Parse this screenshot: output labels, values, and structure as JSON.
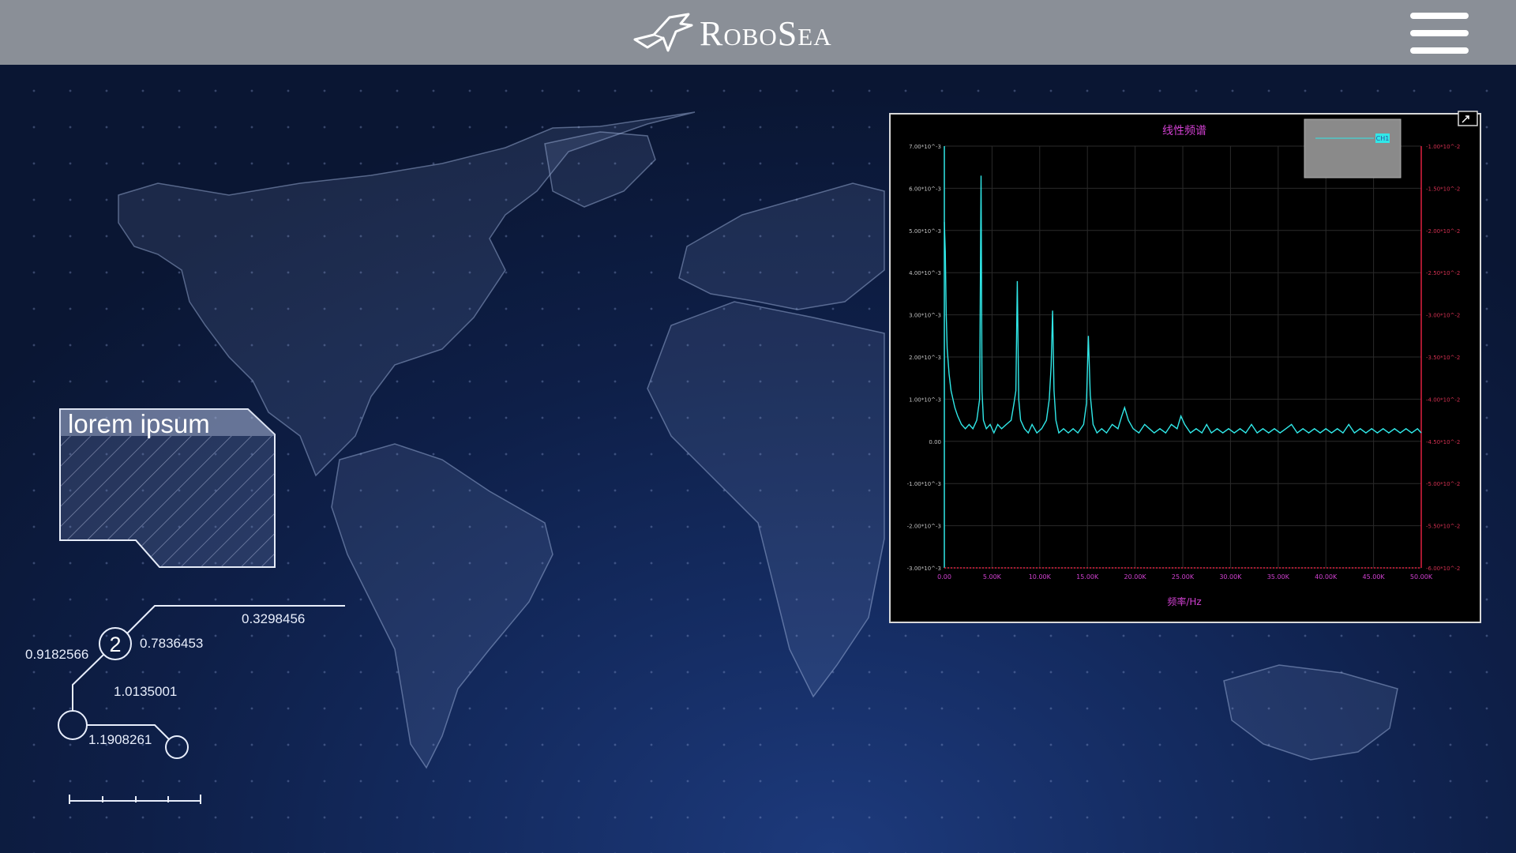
{
  "header": {
    "brand": "RoboSea",
    "logo_icon": "robosea-fish-icon",
    "menu_icon": "hamburger-menu-icon"
  },
  "info_card": {
    "title": "lorem ipsum"
  },
  "network": {
    "node_label": "2",
    "labels": [
      "0.3298456",
      "0.9182566",
      "0.7836453",
      "1.0135001",
      "1.1908261"
    ]
  },
  "chart_data": {
    "type": "line",
    "title": "线性频谱",
    "xlabel": "频率/Hz",
    "legend": {
      "placement": "top-right",
      "entries": [
        "CH1"
      ]
    },
    "x_ticks": [
      "0.00",
      "5.00K",
      "10.00K",
      "15.00K",
      "20.00K",
      "25.00K",
      "30.00K",
      "35.00K",
      "40.00K",
      "45.00K",
      "50.00K"
    ],
    "y_ticks_left": [
      "7.00*10^-3",
      "6.00*10^-3",
      "5.00*10^-3",
      "4.00*10^-3",
      "3.00*10^-3",
      "2.00*10^-3",
      "1.00*10^-3",
      "0.00",
      "-1.00*10^-3",
      "-2.00*10^-3",
      "-3.00*10^-3"
    ],
    "y_ticks_right": [
      "-1.00*10^-2",
      "-1.50*10^-2",
      "-2.00*10^-2",
      "-2.50*10^-2",
      "-3.00*10^-2",
      "-3.50*10^-2",
      "-4.00*10^-2",
      "-4.50*10^-2",
      "-5.00*10^-2",
      "-5.50*10^-2",
      "-6.00*10^-2"
    ],
    "xlim": [
      0,
      50000
    ],
    "ylim": [
      -0.003,
      0.007
    ],
    "grid": true,
    "series": [
      {
        "name": "CH1",
        "color": "#30e8e8",
        "x": [
          0,
          100,
          200,
          300,
          500,
          700,
          900,
          1100,
          1400,
          1800,
          2200,
          2600,
          3000,
          3400,
          3700,
          3850,
          3950,
          4100,
          4400,
          4800,
          5200,
          5600,
          6000,
          6500,
          7000,
          7300,
          7500,
          7650,
          7800,
          8000,
          8400,
          8800,
          9200,
          9700,
          10200,
          10700,
          11000,
          11200,
          11350,
          11500,
          11700,
          12000,
          12500,
          13000,
          13500,
          14000,
          14600,
          14900,
          15100,
          15300,
          15600,
          16000,
          16500,
          17000,
          17600,
          18200,
          18600,
          18900,
          19300,
          19800,
          20400,
          21000,
          21500,
          22000,
          22600,
          23200,
          23800,
          24400,
          24800,
          25200,
          25800,
          26400,
          27000,
          27500,
          28000,
          28600,
          29200,
          29800,
          30400,
          31000,
          31600,
          32200,
          32800,
          33400,
          34000,
          34600,
          35200,
          35800,
          36400,
          37000,
          37600,
          38200,
          38800,
          39400,
          40000,
          40600,
          41200,
          41800,
          42400,
          43000,
          43600,
          44200,
          44800,
          45400,
          46000,
          46600,
          47200,
          47800,
          48400,
          49000,
          49600,
          50000
        ],
        "values": [
          0.0052,
          0.0045,
          0.003,
          0.0022,
          0.0016,
          0.0012,
          0.001,
          0.0008,
          0.0006,
          0.0004,
          0.0003,
          0.0004,
          0.0003,
          0.0005,
          0.001,
          0.0063,
          0.0012,
          0.0005,
          0.0003,
          0.0004,
          0.0002,
          0.0004,
          0.0003,
          0.0004,
          0.0005,
          0.0009,
          0.0012,
          0.0038,
          0.001,
          0.0005,
          0.0003,
          0.0002,
          0.0004,
          0.0002,
          0.0003,
          0.0005,
          0.001,
          0.0018,
          0.0031,
          0.0012,
          0.0005,
          0.0002,
          0.0003,
          0.0002,
          0.0003,
          0.0002,
          0.0004,
          0.0009,
          0.0025,
          0.0011,
          0.0004,
          0.0002,
          0.0003,
          0.0002,
          0.0004,
          0.0003,
          0.0006,
          0.0008,
          0.0005,
          0.0003,
          0.0002,
          0.0004,
          0.0003,
          0.0002,
          0.0003,
          0.0002,
          0.0004,
          0.0003,
          0.0006,
          0.0004,
          0.0002,
          0.0003,
          0.0002,
          0.0004,
          0.0002,
          0.0003,
          0.0002,
          0.0003,
          0.0002,
          0.0003,
          0.0002,
          0.0004,
          0.0002,
          0.0003,
          0.0002,
          0.0003,
          0.0002,
          0.0003,
          0.0004,
          0.0002,
          0.0003,
          0.0002,
          0.0003,
          0.0002,
          0.0003,
          0.0002,
          0.0003,
          0.0002,
          0.0004,
          0.0002,
          0.0003,
          0.0002,
          0.0003,
          0.0002,
          0.0003,
          0.0002,
          0.0003,
          0.0002,
          0.0003,
          0.0002,
          0.0003,
          0.0002
        ]
      }
    ]
  }
}
